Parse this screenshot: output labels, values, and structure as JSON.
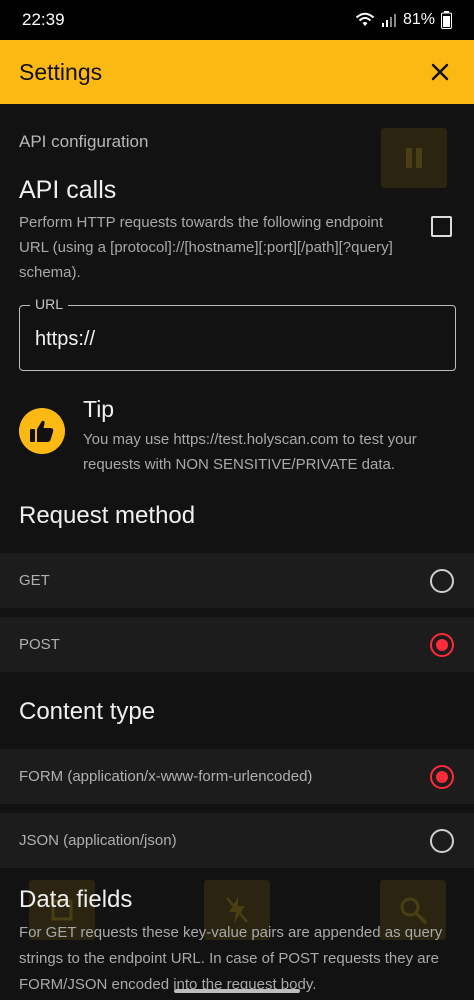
{
  "status": {
    "time": "22:39",
    "battery": "81%"
  },
  "app_bar": {
    "title": "Settings"
  },
  "api": {
    "section_label": "API configuration",
    "title": "API calls",
    "description": "Perform HTTP requests towards the following endpoint URL (using a [protocol]://[hostname][:port][/path][?query] schema).",
    "url_label": "URL",
    "url_value": "https://"
  },
  "tip": {
    "title": "Tip",
    "text": "You may use https://test.holyscan.com to test your requests with NON SENSITIVE/PRIVATE data."
  },
  "request_method": {
    "title": "Request method",
    "options": [
      {
        "label": "GET",
        "checked": false
      },
      {
        "label": "POST",
        "checked": true
      }
    ]
  },
  "content_type": {
    "title": "Content type",
    "options": [
      {
        "label": "FORM (application/x-www-form-urlencoded)",
        "checked": true
      },
      {
        "label": "JSON (application/json)",
        "checked": false
      }
    ]
  },
  "data_fields": {
    "title": "Data fields",
    "description": "For GET requests these key-value pairs are appended as query strings to the endpoint URL. In case of POST requests they are FORM/JSON encoded into the request body."
  },
  "colors": {
    "accent": "#fdb913",
    "radio_checked": "#ff2a3a",
    "background": "#121212"
  }
}
